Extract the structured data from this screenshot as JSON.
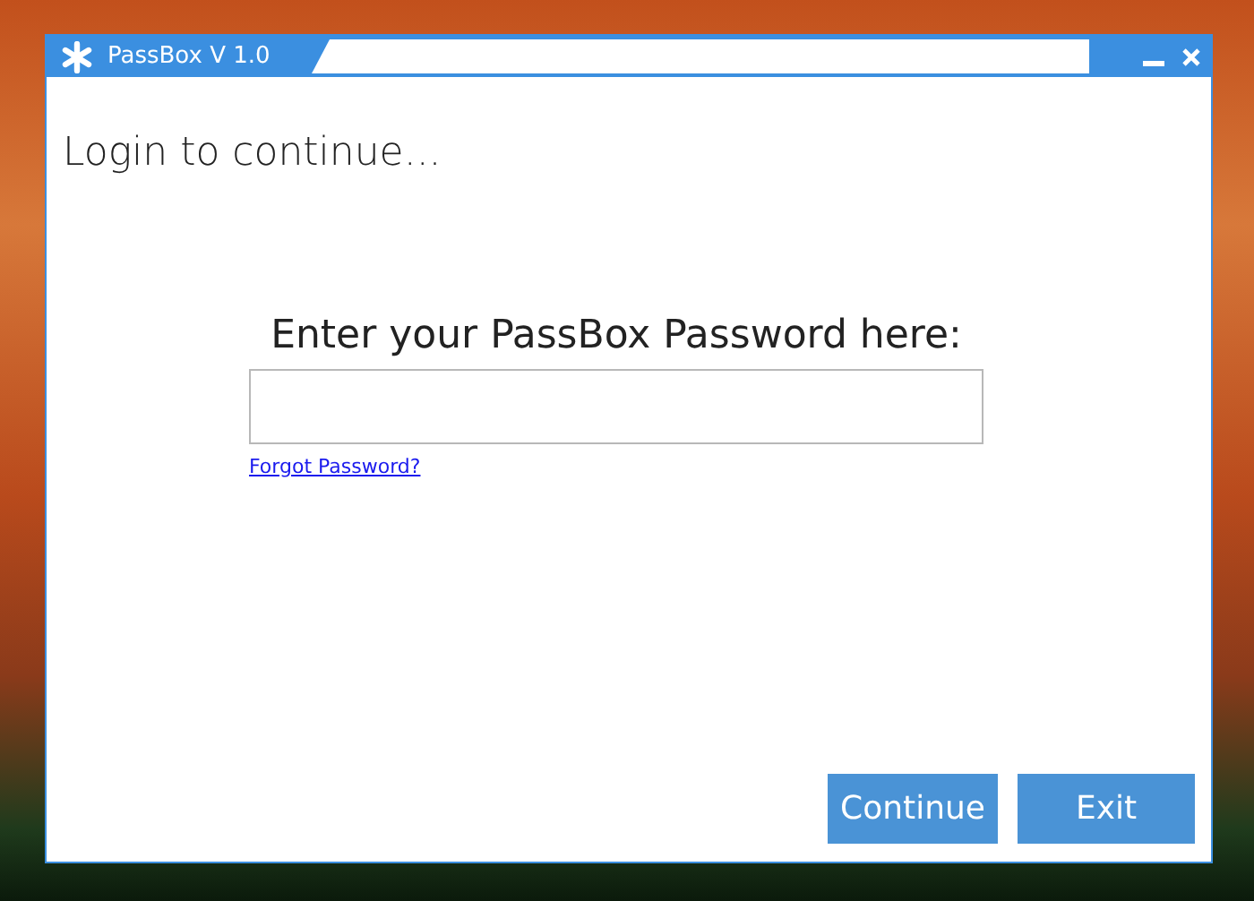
{
  "window": {
    "title": "PassBox V 1.0"
  },
  "heading": "Login to continue...",
  "password": {
    "label": "Enter your PassBox Password here:"
  },
  "forgot_link": "Forgot Password?",
  "buttons": [
    "Continue",
    "Exit"
  ]
}
